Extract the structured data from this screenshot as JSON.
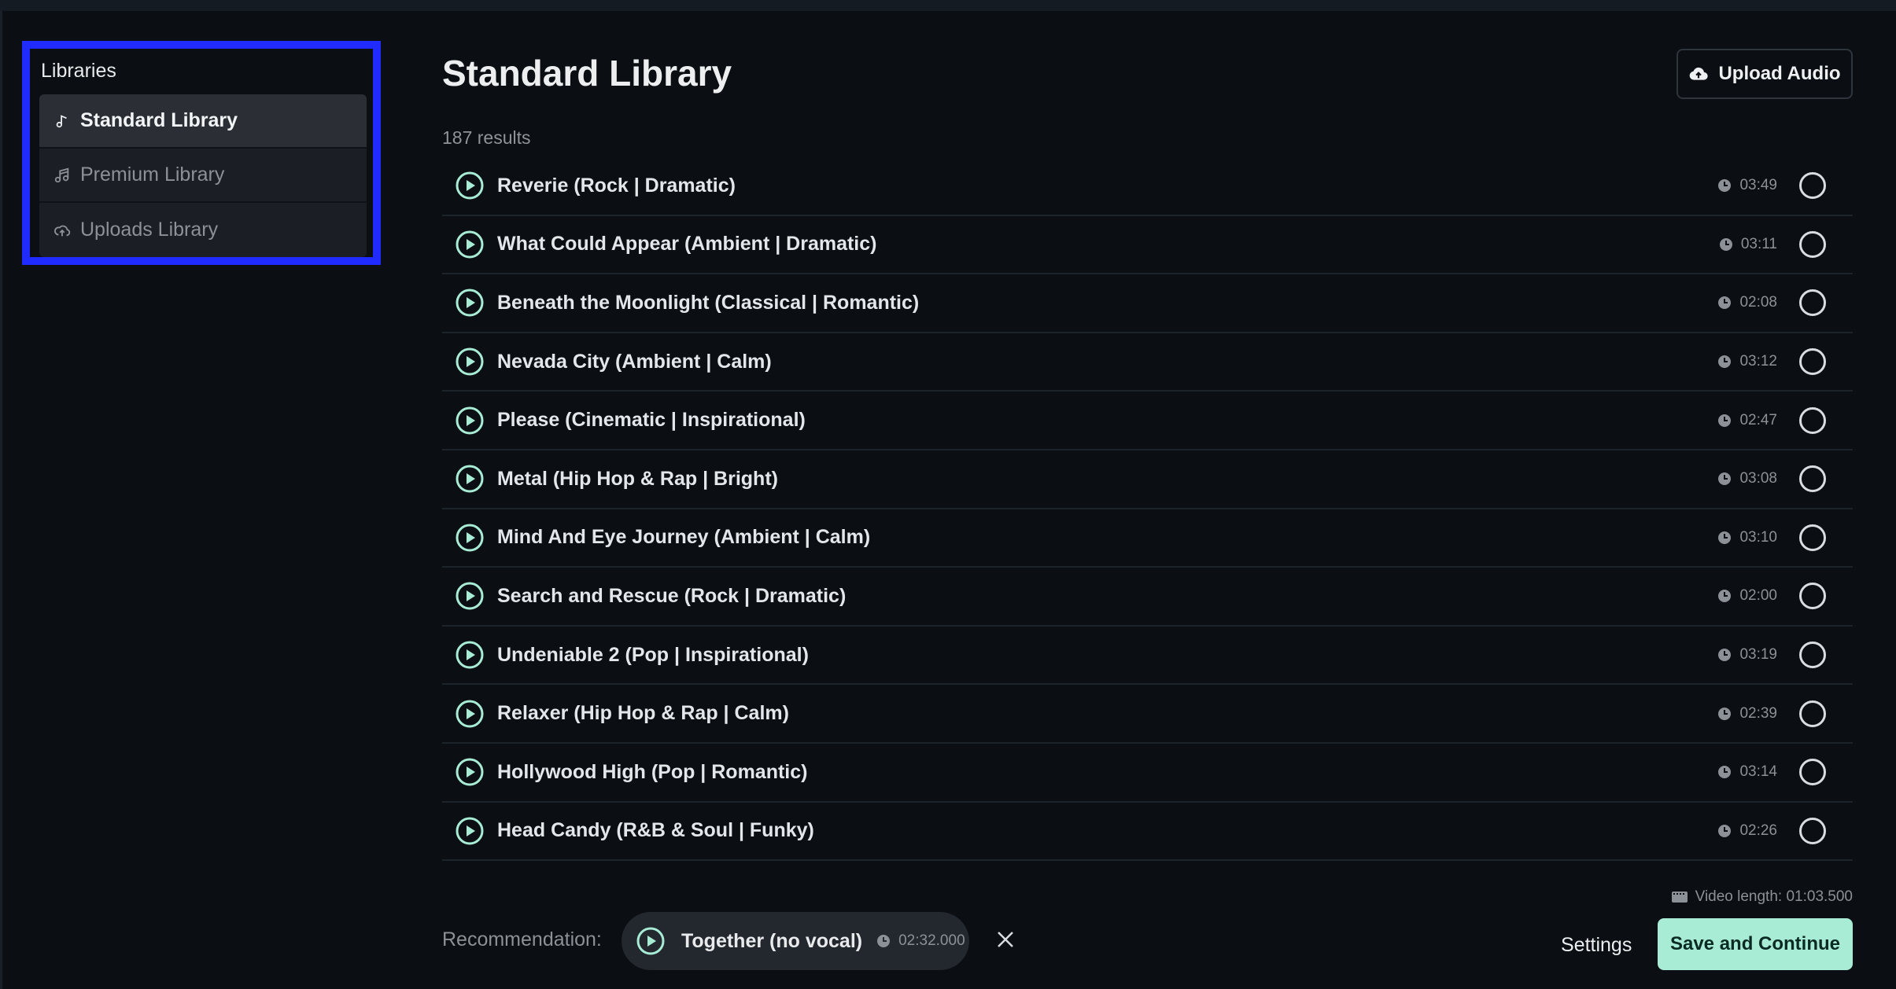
{
  "sidebar": {
    "title": "Libraries",
    "items": [
      {
        "label": "Standard Library",
        "icon": "music-note-icon",
        "active": true
      },
      {
        "label": "Premium Library",
        "icon": "music-notes-icon",
        "active": false
      },
      {
        "label": "Uploads Library",
        "icon": "cloud-upload-icon",
        "active": false
      }
    ]
  },
  "main": {
    "title": "Standard Library",
    "upload_label": "Upload Audio",
    "results": "187 results",
    "tracks": [
      {
        "title": "Reverie (Rock | Dramatic)",
        "duration": "03:49"
      },
      {
        "title": "What Could Appear (Ambient | Dramatic)",
        "duration": "03:11"
      },
      {
        "title": "Beneath the Moonlight (Classical | Romantic)",
        "duration": "02:08"
      },
      {
        "title": "Nevada City (Ambient | Calm)",
        "duration": "03:12"
      },
      {
        "title": "Please (Cinematic | Inspirational)",
        "duration": "02:47"
      },
      {
        "title": "Metal (Hip Hop & Rap | Bright)",
        "duration": "03:08"
      },
      {
        "title": "Mind And Eye Journey (Ambient | Calm)",
        "duration": "03:10"
      },
      {
        "title": "Search and Rescue (Rock | Dramatic)",
        "duration": "02:00"
      },
      {
        "title": "Undeniable 2 (Pop | Inspirational)",
        "duration": "03:19"
      },
      {
        "title": "Relaxer (Hip Hop & Rap | Calm)",
        "duration": "02:39"
      },
      {
        "title": "Hollywood High (Pop | Romantic)",
        "duration": "03:14"
      },
      {
        "title": "Head Candy (R&B & Soul | Funky)",
        "duration": "02:26"
      }
    ]
  },
  "footer": {
    "video_length": "Video length: 01:03.500",
    "recommendation_label": "Recommendation:",
    "recommendation_title": "Together (no vocal)",
    "recommendation_duration": "02:32.000",
    "settings_label": "Settings",
    "save_label": "Save and Continue"
  },
  "colors": {
    "accent": "#a8ecd5",
    "highlight_border": "#1f2bff",
    "background": "#0b0e12"
  }
}
